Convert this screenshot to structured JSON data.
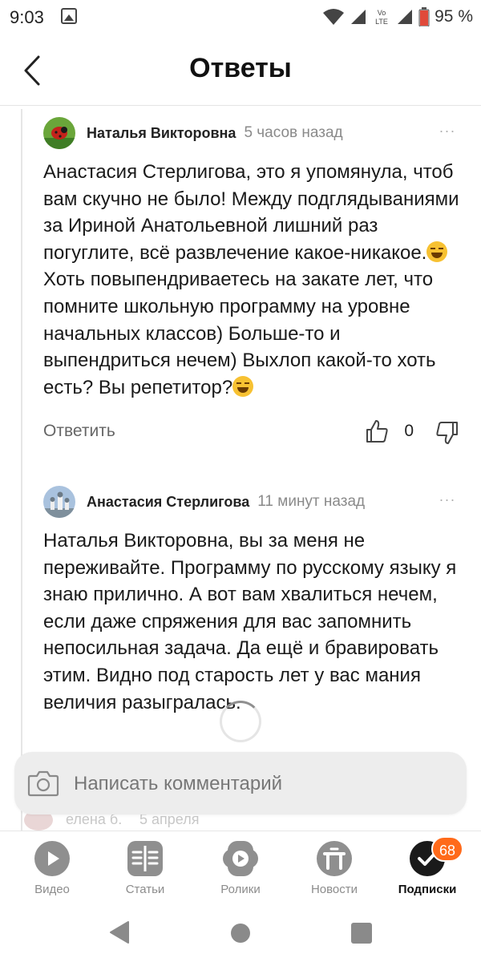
{
  "status": {
    "time": "9:03",
    "battery": "95 %",
    "network_label": "LTE",
    "volte_label": "Vo"
  },
  "header": {
    "title": "Ответы"
  },
  "comments": [
    {
      "author": "Наталья Викторовна",
      "time": "5 часов назад",
      "text_before_emoji": "Анастасия Стерлигова, это я упомянула, чтоб вам скучно не было! Между подглядываниями за Ириной Анатольевной лишний раз погуглите, всё развлечение какое-никакое.",
      "text_after_emoji": "\nХоть повыпендриваетесь на закате лет, что помните школьную программу на уровне начальных классов) Больше-то и выпендриться нечем) Выхлоп какой-то хоть есть? Вы репетитор?",
      "reply_label": "Ответить",
      "like_count": "0"
    },
    {
      "author": "Анастасия Стерлигова",
      "time": "11 минут назад",
      "text": "Наталья Викторовна, вы за меня не переживайте. Программу по русскому языку я знаю прилично. А вот вам хвалиться нечем, если даже спряжения для вас запомнить непосильная задача. Да ещё и бравировать этим. Видно под старость лет у вас мания величия разыгралась."
    }
  ],
  "peek": {
    "name": "елена б.",
    "date": "5 апреля"
  },
  "compose": {
    "placeholder": "Написать комментарий"
  },
  "tabs": [
    {
      "label": "Видео",
      "icon": "video-icon"
    },
    {
      "label": "Статьи",
      "icon": "articles-icon"
    },
    {
      "label": "Ролики",
      "icon": "clips-icon"
    },
    {
      "label": "Новости",
      "icon": "news-icon"
    },
    {
      "label": "Подписки",
      "icon": "subscriptions-icon",
      "badge": "68",
      "active": true
    }
  ],
  "colors": {
    "accent_badge": "#ff6a1a",
    "muted_text": "#8a8a8a"
  }
}
